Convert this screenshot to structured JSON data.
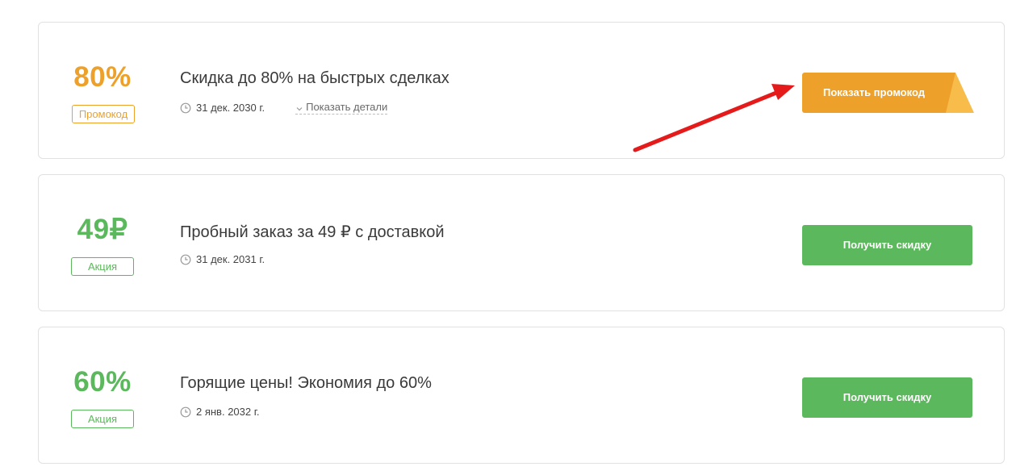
{
  "colors": {
    "orange": "#eda12a",
    "orange_fold": "#f7bc49",
    "green": "#5cb85c",
    "arrow_red": "#e51b1b"
  },
  "offers": [
    {
      "amount": "80%",
      "badge": "Промокод",
      "title": "Скидка до 80% на быстрых сделках",
      "date": "31 дек. 2030 г.",
      "details_link": "Показать детали",
      "button": "Показать промокод"
    },
    {
      "amount": "49₽",
      "badge": "Акция",
      "title": "Пробный заказ за 49 ₽ с доставкой",
      "date": "31 дек. 2031 г.",
      "button": "Получить скидку"
    },
    {
      "amount": "60%",
      "badge": "Акция",
      "title": "Горящие цены! Экономия до 60%",
      "date": "2 янв. 2032 г.",
      "button": "Получить скидку"
    }
  ]
}
